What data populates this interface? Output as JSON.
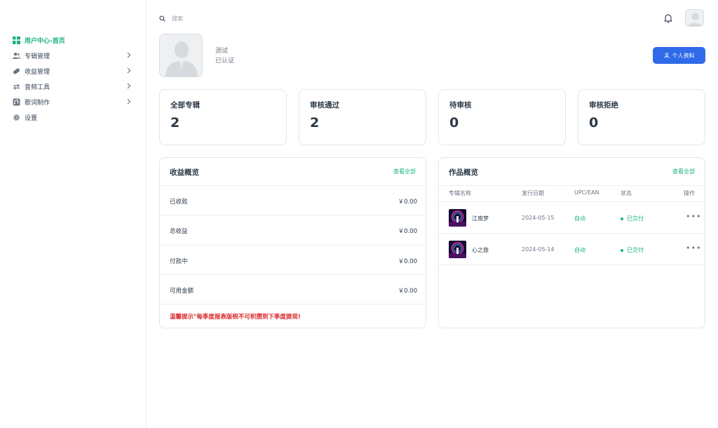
{
  "sidebar": {
    "items": [
      {
        "label": "用户中心-首页",
        "icon": "dashboard-icon",
        "active": true
      },
      {
        "label": "专辑管理",
        "icon": "users-icon",
        "arrow": true
      },
      {
        "label": "收益管理",
        "icon": "pill-icon",
        "arrow": true
      },
      {
        "label": "音频工具",
        "icon": "swap-icon",
        "arrow": true
      },
      {
        "label": "歌词制作",
        "icon": "lyrics-icon",
        "arrow": true
      },
      {
        "label": "设置",
        "icon": "gear-icon",
        "arrow": false
      }
    ]
  },
  "header": {
    "search_placeholder": "搜索",
    "bell_icon": "bell-icon",
    "avatar_icon": "avatar-icon"
  },
  "profile": {
    "name": "测试",
    "status": "已认证",
    "button_label": "个人资料"
  },
  "stats": [
    {
      "label": "全部专辑",
      "value": "2"
    },
    {
      "label": "审核通过",
      "value": "2"
    },
    {
      "label": "待审核",
      "value": "0"
    },
    {
      "label": "审核拒绝",
      "value": "0"
    }
  ],
  "income": {
    "title": "收益概览",
    "link": "查看全部",
    "rows": [
      {
        "label": "已收款",
        "value": "￥0.00"
      },
      {
        "label": "总收益",
        "value": "￥0.00"
      },
      {
        "label": "付款中",
        "value": "￥0.00"
      },
      {
        "label": "可用金额",
        "value": "￥0.00"
      }
    ],
    "warning": "温馨提示\"每季度报表版税不可积攒到下季度提现!"
  },
  "works": {
    "title": "作品概览",
    "link": "查看全部",
    "columns": [
      "专辑名称",
      "发行日期",
      "UPC/EAN",
      "状态",
      "操作"
    ],
    "rows": [
      {
        "name": "江南梦",
        "date": "2024-05-15",
        "upc": "自动",
        "status": "已交付",
        "more": "•••"
      },
      {
        "name": "心之旅",
        "date": "2024-05-14",
        "upc": "自动",
        "status": "已交付",
        "more": "•••"
      }
    ]
  },
  "colors": {
    "accent": "#19b37e",
    "primary_button": "#2f6ae8",
    "warning": "#d9282b"
  }
}
